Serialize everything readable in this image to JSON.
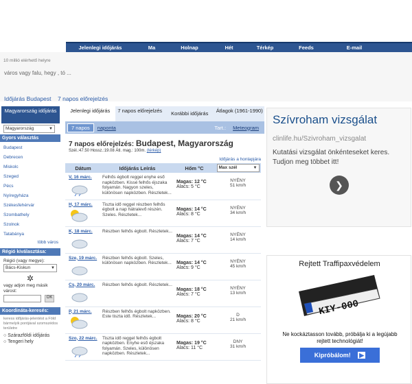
{
  "nav": [
    {
      "label": "Jelenlegi időjárás",
      "w": 100
    },
    {
      "label": "Ma",
      "w": 50
    },
    {
      "label": "Holnap",
      "w": 60
    },
    {
      "label": "Hét",
      "w": 55
    },
    {
      "label": "Térkép",
      "w": 50
    },
    {
      "label": "Feeds",
      "w": 70
    },
    {
      "label": "E-mail",
      "w": 70
    }
  ],
  "header": {
    "count_text": "10 millió elérhető helyre",
    "search_placeholder": "város vagy falu, hegy , tó ...",
    "crumb1": "Időjárás Budapest",
    "crumb2": "7 napos előrejelzés"
  },
  "sidebar": {
    "title": "Magyarország időjárás",
    "country": "Magyarország",
    "quick_head": "Gyors választás",
    "cities": [
      "Budapest",
      "Debrecen",
      "Miskolc",
      "Szeged",
      "Pécs",
      "Nyíregyháza",
      "Székesfehérvár",
      "Szombathely",
      "Szolnok",
      "Tatabánya"
    ],
    "more": "több város",
    "region_head": "Régió kiválasztása:",
    "region_label": "Régió (vagy megye):",
    "region_value": "Bács-Kiskun",
    "city_prompt": "vagy adjon meg másik várost:",
    "go_label": "OK",
    "coord_head": "Koordináta-keresés:",
    "coord_text": "keress időjárás-jelentést a Föld bármelyik pontjával szomszédos területre",
    "radio1": "Szárazföldi időjárás",
    "radio2": "Tengeri hely"
  },
  "tabs": [
    {
      "label": "Jelenlegi időjárás"
    },
    {
      "label": "7 napos előrejelzés"
    },
    {
      "label": "Korábbi időjárás"
    },
    {
      "label": "Átlagok (1961-1990)"
    }
  ],
  "subtabs": {
    "a": "7 napos",
    "b": "naponta",
    "c": "Tart.:",
    "d": "Meteogram"
  },
  "location": {
    "prefix": "7 napos előrejelzés:",
    "name": "Budapest, Magyarország",
    "coords": "Szél.:47.50 Hossz.:19.08 Átl. mag.: 100m.",
    "map_link": "(térkép)",
    "site_link": "Időjárás a honlapjára"
  },
  "table": {
    "h_date": "Dátum",
    "h_desc": "Időjárás Leírás",
    "h_temp": "Hőm °C",
    "h_wind": "Max szél"
  },
  "rows": [
    {
      "date": "V, 16 márc.",
      "desc": "Felhős égbolt reggel enyhe eső napközben. Kissé felhős éjszaka folyamán. Nagyon szeles, különösen napközben. Részletek...",
      "high": "Magas: 12 °C",
      "low": "Alacs: 5 °C",
      "dir": "NYÉNY",
      "speed": "51 km/h"
    },
    {
      "date": "H, 17 márc.",
      "desc": "Tiszta idő reggel részben felhős égbolt a nap hátralevő részén. Szeles. Részletek...",
      "high": "Magas: 14 °C",
      "low": "Alacs: 8 °C",
      "dir": "NYÉNY",
      "speed": "34 km/h"
    },
    {
      "date": "K, 18 márc.",
      "desc": "Részben felhős égbolt. Részletek...",
      "high": "Magas: 14 °C",
      "low": "Alacs: 7 °C",
      "dir": "NYÉNY",
      "speed": "14 km/h"
    },
    {
      "date": "Sze, 19 márc.",
      "desc": "Részben felhős égbolt. Szeles, különösen napközben. Részletek...",
      "high": "Magas: 14 °C",
      "low": "Alacs: 9 °C",
      "dir": "NYÉNY",
      "speed": "45 km/h"
    },
    {
      "date": "Cs, 20 márc.",
      "desc": "Részben felhős égbolt. Részletek...",
      "high": "Magas: 18 °C",
      "low": "Alacs: 7 °C",
      "dir": "NYÉNY",
      "speed": "13 km/h"
    },
    {
      "date": "P, 21 márc.",
      "desc": "Részben felhős égbolt napközben. Este tiszta idő. Részletek...",
      "high": "Magas: 20 °C",
      "low": "Alacs: 8 °C",
      "dir": "D",
      "speed": "21 km/h"
    },
    {
      "date": "Szo, 22 márc.",
      "desc": "Tiszta idő reggel felhős égbolt napközben. Enyhe eső éjszaka folyamán. Szeles, különösen napközben. Részletek...",
      "high": "Magas: 19 °C",
      "low": "Alacs: 11 °C",
      "dir": "DNY",
      "speed": "31 km/h"
    }
  ],
  "ad1": {
    "title": "Szívroham vizsgálat",
    "url": "clinlife.hu/Szivroham_vizsgalat",
    "text": "Kutatási vizsgálat önkénteseket keres. Tudjon meg többet itt!"
  },
  "ad2": {
    "title": "Rejtett Traffipaxvédelem",
    "plate": "KIY-000",
    "text": "Ne kockáztasson tovább, próbálja ki a legújabb rejtett technológiát!",
    "button": "Kipróbálom!"
  }
}
